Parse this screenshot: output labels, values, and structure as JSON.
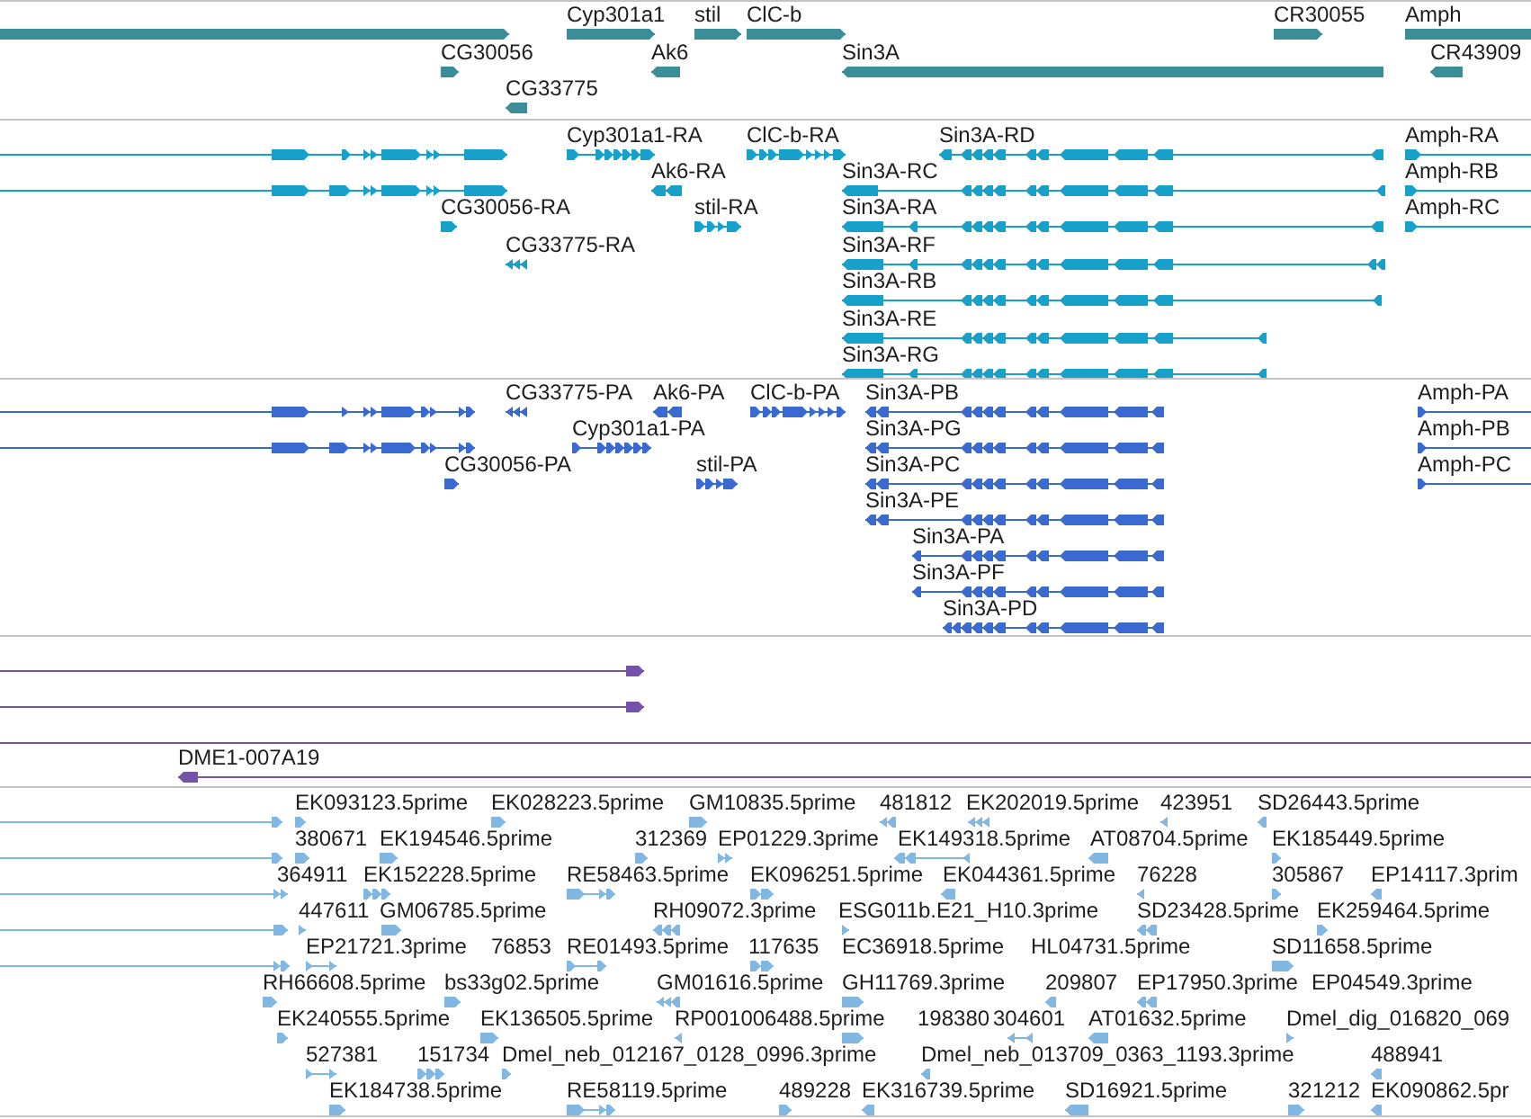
{
  "tracks": [
    {
      "kind": "gene",
      "features": [
        {
          "reverse": false
        },
        {
          "label": "Cyp301a1",
          "reverse": false
        },
        {
          "label": "stil",
          "reverse": false
        },
        {
          "label": "ClC-b",
          "reverse": false
        },
        {
          "label": "CR30055",
          "reverse": false
        },
        {
          "label": "Amph",
          "reverse": false
        },
        {
          "label": "CG30056",
          "reverse": false
        },
        {
          "label": "Ak6",
          "reverse": true
        },
        {
          "label": "Sin3A",
          "reverse": true
        },
        {
          "label": "CR43909",
          "reverse": true
        },
        {
          "label": "CG33775",
          "reverse": true
        }
      ]
    },
    {
      "kind": "transcript",
      "features": [
        {
          "reverse": false
        },
        {
          "label": "Cyp301a1-RA",
          "reverse": false
        },
        {
          "label": "ClC-b-RA",
          "reverse": false
        },
        {
          "label": "Sin3A-RD",
          "reverse": true
        },
        {
          "label": "Amph-RA",
          "reverse": false
        },
        {
          "reverse": false
        },
        {
          "label": "Ak6-RA",
          "reverse": true
        },
        {
          "label": "Sin3A-RC",
          "reverse": true
        },
        {
          "label": "Amph-RB",
          "reverse": false
        },
        {
          "label": "CG30056-RA",
          "reverse": false
        },
        {
          "label": "stil-RA",
          "reverse": false
        },
        {
          "label": "Sin3A-RA",
          "reverse": true
        },
        {
          "label": "Amph-RC",
          "reverse": false
        },
        {
          "label": "CG33775-RA",
          "reverse": true
        },
        {
          "label": "Sin3A-RF",
          "reverse": true
        },
        {
          "label": "Sin3A-RB",
          "reverse": true
        },
        {
          "label": "Sin3A-RE",
          "reverse": true
        },
        {
          "label": "Sin3A-RG",
          "reverse": true
        }
      ]
    },
    {
      "kind": "protein",
      "features": [
        {
          "reverse": false
        },
        {
          "label": "CG33775-PA",
          "reverse": true
        },
        {
          "label": "Ak6-PA",
          "reverse": true
        },
        {
          "label": "ClC-b-PA",
          "reverse": false
        },
        {
          "label": "Sin3A-PB",
          "reverse": true
        },
        {
          "label": "Amph-PA",
          "reverse": false
        },
        {
          "reverse": false
        },
        {
          "label": "Cyp301a1-PA",
          "reverse": false
        },
        {
          "label": "Sin3A-PG",
          "reverse": true
        },
        {
          "label": "Amph-PB",
          "reverse": false
        },
        {
          "label": "CG30056-PA",
          "reverse": false
        },
        {
          "label": "stil-PA",
          "reverse": false
        },
        {
          "label": "Sin3A-PC",
          "reverse": true
        },
        {
          "label": "Amph-PC",
          "reverse": false
        },
        {
          "label": "Sin3A-PE",
          "reverse": true
        },
        {
          "label": "Sin3A-PA",
          "reverse": true
        },
        {
          "label": "Sin3A-PF",
          "reverse": true
        },
        {
          "label": "Sin3A-PD",
          "reverse": true
        }
      ]
    },
    {
      "kind": "alignment",
      "features": [
        {
          "kind": "arrow",
          "reverse": false
        },
        {
          "kind": "arrow",
          "reverse": false
        },
        {
          "kind": "line"
        },
        {
          "kind": "arrow",
          "label": "DME1-007A19",
          "reverse": true
        }
      ]
    },
    {
      "kind": "est",
      "features": [
        {
          "reverse": false
        },
        {
          "label": "EK093123.5prime",
          "reverse": false
        },
        {
          "label": "EK028223.5prime",
          "reverse": false
        },
        {
          "label": "GM10835.5prime",
          "reverse": false
        },
        {
          "label": "481812",
          "reverse": true
        },
        {
          "label": "EK202019.5prime",
          "reverse": true
        },
        {
          "label": "423951",
          "reverse": true
        },
        {
          "label": "SD26443.5prime",
          "reverse": true
        },
        {
          "reverse": false
        },
        {
          "label": "380671",
          "reverse": false
        },
        {
          "label": "EK194546.5prime",
          "reverse": false
        },
        {
          "label": "312369",
          "reverse": false
        },
        {
          "label": "EP01229.3prime",
          "reverse": false
        },
        {
          "label": "EK149318.5prime",
          "reverse": true
        },
        {
          "label": "AT08704.5prime",
          "reverse": true
        },
        {
          "label": "EK185449.5prime",
          "reverse": false
        },
        {
          "reverse": false
        },
        {
          "label": "364911"
        },
        {
          "label": "EK152228.5prime",
          "reverse": false
        },
        {
          "label": "RE58463.5prime",
          "reverse": false
        },
        {
          "label": "EK096251.5prime",
          "reverse": false
        },
        {
          "label": "EK044361.5prime",
          "reverse": true
        },
        {
          "label": "76228",
          "reverse": true
        },
        {
          "label": "305867",
          "reverse": false
        },
        {
          "label": "EP14117.3prim",
          "reverse": true
        },
        {
          "reverse": false
        },
        {
          "label": "447611",
          "reverse": false
        },
        {
          "label": "GM06785.5prime",
          "reverse": false
        },
        {
          "label": "RH09072.3prime",
          "reverse": true
        },
        {
          "label": "ESG011b.E21_H10.3prime",
          "reverse": false
        },
        {
          "label": "SD23428.5prime",
          "reverse": true
        },
        {
          "label": "EK259464.5prime",
          "reverse": false
        },
        {
          "reverse": false
        },
        {
          "label": "EP21721.3prime",
          "reverse": false
        },
        {
          "label": "76853"
        },
        {
          "label": "RE01493.5prime",
          "reverse": false
        },
        {
          "label": "117635",
          "reverse": false
        },
        {
          "label": "EC36918.5prime"
        },
        {
          "label": "HL04731.5prime"
        },
        {
          "label": "SD11658.5prime",
          "reverse": false
        },
        {
          "label": "RH66608.5prime",
          "reverse": false
        },
        {
          "label": "bs33g02.5prime",
          "reverse": false
        },
        {
          "label": "GM01616.5prime",
          "reverse": true
        },
        {
          "label": "GH11769.3prime",
          "reverse": false
        },
        {
          "label": "209807",
          "reverse": true
        },
        {
          "label": "EP17950.3prime",
          "reverse": true
        },
        {
          "label": "EP04549.3prime"
        },
        {
          "label": "EK240555.5prime",
          "reverse": false
        },
        {
          "label": "EK136505.5prime",
          "reverse": false
        },
        {
          "label": "RP001006488.5prime",
          "reverse": true
        },
        {
          "reverse": false
        },
        {
          "label": "198380"
        },
        {
          "label": "304601",
          "reverse": true
        },
        {
          "label": "AT01632.5prime",
          "reverse": true
        },
        {
          "label": "Dmel_dig_016820_069",
          "reverse": false
        },
        {
          "label": "527381",
          "reverse": false
        },
        {
          "label": "151734",
          "reverse": false
        },
        {
          "label": "Dmel_neb_012167_0128_0996.3prime",
          "reverse": false
        },
        {
          "label": "Dmel_neb_013709_0363_1193.3prime",
          "reverse": true
        },
        {
          "label": "488941",
          "reverse": true
        },
        {
          "label": "EK184738.5prime",
          "reverse": false
        },
        {
          "label": "RE58119.5prime",
          "reverse": false
        },
        {
          "label": "489228",
          "reverse": false
        },
        {
          "label": "EK316739.5prime",
          "reverse": true
        },
        {
          "label": "SD16921.5prime",
          "reverse": true
        },
        {
          "label": "321212",
          "reverse": false
        },
        {
          "label": "EK090862.5pr",
          "reverse": true
        }
      ]
    }
  ]
}
